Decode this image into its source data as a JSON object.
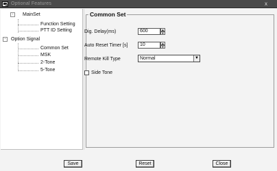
{
  "window": {
    "title": "Optional Features",
    "close_glyph": "x",
    "icon": "app-icon"
  },
  "tree": {
    "groups": [
      {
        "label": "MainSet",
        "toggle": "-",
        "children": [
          "Function Setting",
          "PTT ID Setting"
        ]
      },
      {
        "label": "Option Signal",
        "toggle": "-",
        "children": [
          "Common Set",
          "MSK",
          "2-Tone",
          "5-Tone"
        ]
      }
    ]
  },
  "common_set": {
    "title": "Common Set",
    "dig_delay": {
      "label": "Dig. Delay(ms)",
      "value": "600"
    },
    "auto_reset_timer": {
      "label": "Auto Reset Timer [s]",
      "value": "10"
    },
    "remote_kill_type": {
      "label": "Remote Kill Type",
      "value": "Normal"
    },
    "side_tone": {
      "label": "Side Tone",
      "checked": false
    }
  },
  "buttons": {
    "save": "Save",
    "reset": "Reset",
    "close": "Close"
  }
}
